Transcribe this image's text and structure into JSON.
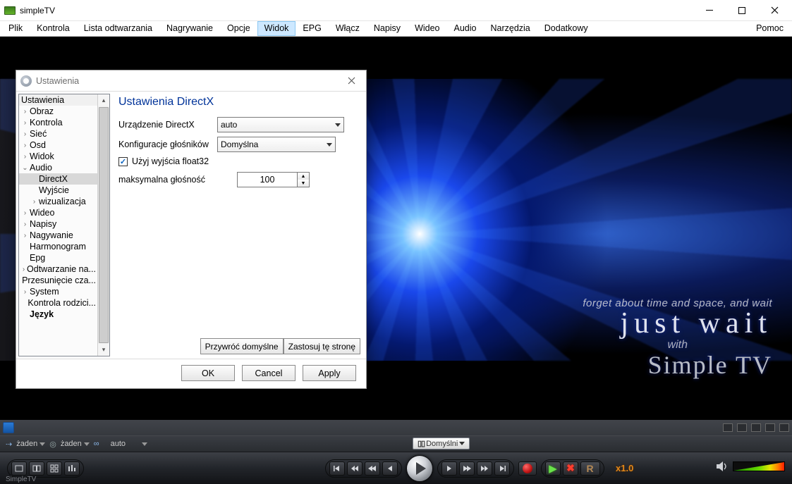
{
  "app": {
    "title": "simpleTV"
  },
  "menu": {
    "items": [
      "Plik",
      "Kontrola",
      "Lista odtwarzania",
      "Nagrywanie",
      "Opcje",
      "Widok",
      "EPG",
      "Włącz",
      "Napisy",
      "Wideo",
      "Audio",
      "Narzędzia",
      "Dodatkowy"
    ],
    "help": "Pomoc",
    "selected": "Widok"
  },
  "splash": {
    "line1": "forget about time and space, and wait",
    "line2": "just wait",
    "line3": "with",
    "line4": "Simple TV"
  },
  "panel": {
    "drop1": "żaden",
    "drop2": "żaden",
    "drop3": "auto",
    "dolby": "Domyślni",
    "speed": "x1.0",
    "footer": "SimpleTV"
  },
  "dialog": {
    "title": "Ustawienia",
    "tree": {
      "header": "Ustawienia",
      "items": [
        {
          "label": "Obraz",
          "exp": ">"
        },
        {
          "label": "Kontrola",
          "exp": ">"
        },
        {
          "label": "Sieć",
          "exp": ">"
        },
        {
          "label": "Osd",
          "exp": ">"
        },
        {
          "label": "Widok",
          "exp": ">"
        },
        {
          "label": "Audio",
          "exp": "v",
          "open": true,
          "children": [
            {
              "label": "DirectX",
              "sel": true
            },
            {
              "label": "Wyjście"
            },
            {
              "label": "wizualizacja",
              "exp": ">"
            }
          ]
        },
        {
          "label": "Wideo",
          "exp": ">"
        },
        {
          "label": "Napisy",
          "exp": ">"
        },
        {
          "label": "Nagywanie",
          "exp": ">"
        },
        {
          "label": "Harmonogram"
        },
        {
          "label": "Epg"
        },
        {
          "label": "Odtwarzanie na...",
          "exp": ">"
        },
        {
          "label": "Przesunięcie cza..."
        },
        {
          "label": "System",
          "exp": ">"
        },
        {
          "label": "Kontrola rodzici..."
        },
        {
          "label": "Język",
          "bold": true
        }
      ]
    },
    "pane": {
      "heading": "Ustawienia DirectX",
      "device_label": "Urządzenie DirectX",
      "device_value": "auto",
      "speakers_label": "Konfiguracje głośników",
      "speakers_value": "Domyślna",
      "float32_label": "Użyj wyjścia float32",
      "float32_checked": true,
      "maxvol_label": "maksymalna głośność",
      "maxvol_value": "100",
      "restore": "Przywróć domyślne",
      "apply_page": "Zastosuj tę stronę"
    },
    "buttons": {
      "ok": "OK",
      "cancel": "Cancel",
      "apply": "Apply"
    }
  }
}
